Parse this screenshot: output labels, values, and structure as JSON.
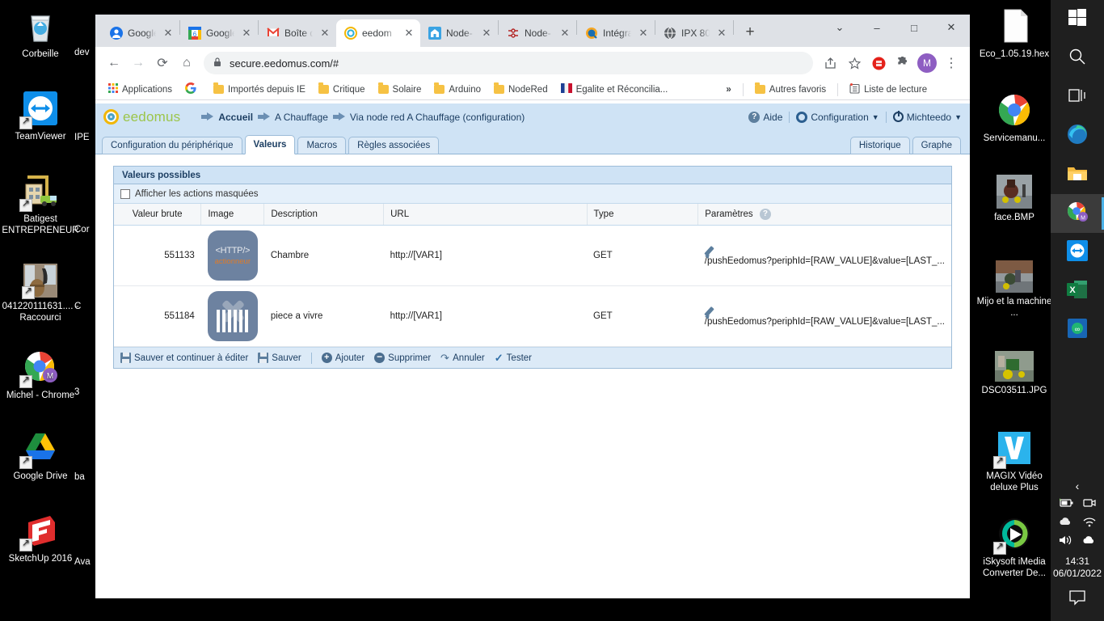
{
  "desktop": {
    "left_icons": [
      {
        "label": "Corbeille",
        "icon": "recycle-bin-icon"
      },
      {
        "label": "TeamViewer",
        "icon": "teamviewer-icon"
      },
      {
        "label": "Batigest ENTREPRENEUR",
        "icon": "batigest-icon"
      },
      {
        "label": "041220111631.... - Raccourci",
        "icon": "image-shortcut-icon"
      },
      {
        "label": "Michel - Chrome",
        "icon": "chrome-profile-icon"
      },
      {
        "label": "Google Drive",
        "icon": "google-drive-icon"
      },
      {
        "label": "SketchUp 2016",
        "icon": "sketchup-icon"
      }
    ],
    "left_icons_clipped": [
      "dev",
      "IPE",
      "Cor",
      "C",
      "3",
      "ba",
      "Ava"
    ],
    "right_icons": [
      {
        "label": "Eco_1.05.19.hex",
        "icon": "file-icon"
      },
      {
        "label": "Servicemanu...",
        "icon": "chrome-icon"
      },
      {
        "label": "face.BMP",
        "icon": "photo-thumbnail-icon"
      },
      {
        "label": "Mijo et la machine ...",
        "icon": "photo-thumbnail-icon"
      },
      {
        "label": "DSC03511.JPG",
        "icon": "photo-thumbnail-icon"
      },
      {
        "label": "MAGIX Vidéo deluxe Plus",
        "icon": "magix-icon"
      },
      {
        "label": "iSkysoft iMedia Converter De...",
        "icon": "iskysoft-icon"
      }
    ]
  },
  "taskbar": {
    "items": [
      {
        "name": "start-button",
        "icon": "windows-logo-icon"
      },
      {
        "name": "search-button",
        "icon": "search-icon"
      },
      {
        "name": "task-view-button",
        "icon": "task-view-icon"
      },
      {
        "name": "edge-button",
        "icon": "edge-icon"
      },
      {
        "name": "file-explorer-button",
        "icon": "folder-icon"
      },
      {
        "name": "chrome-button",
        "icon": "chrome-profile-icon",
        "active": true
      },
      {
        "name": "teamviewer-button",
        "icon": "teamviewer-icon"
      },
      {
        "name": "excel-button",
        "icon": "excel-icon"
      },
      {
        "name": "app-button",
        "icon": "blue-app-icon"
      }
    ],
    "tray": {
      "expand": "show-hidden-icons-icon",
      "icons": [
        "battery-icon",
        "camera-icon",
        "onedrive-cloud-icon",
        "wifi-icon",
        "volume-icon",
        "cloud-upload-icon"
      ],
      "time": "14:31",
      "date": "06/01/2022",
      "notifications": "action-center-icon"
    }
  },
  "browser": {
    "tabs": [
      {
        "title": "Google",
        "favicon": "google-account-icon",
        "active": false
      },
      {
        "title": "Google",
        "favicon": "google-calendar-icon",
        "active": false
      },
      {
        "title": "Boîte d",
        "favicon": "gmail-icon",
        "active": false
      },
      {
        "title": "eedom",
        "favicon": "eedomus-icon",
        "active": true
      },
      {
        "title": "Node-",
        "favicon": "nodered-dashboard-icon",
        "active": false
      },
      {
        "title": "Node-",
        "favicon": "nodered-icon",
        "active": false
      },
      {
        "title": "Intégra",
        "favicon": "integra-icon",
        "active": false
      },
      {
        "title": "IPX 80",
        "favicon": "globe-icon",
        "active": false
      }
    ],
    "new_tab": "+",
    "window_controls": {
      "minimize": "–",
      "maximize": "□",
      "close": "✕",
      "chevron": "⌄"
    },
    "nav": {
      "back": "←",
      "forward": "→",
      "reload": "⟳",
      "home": "⌂"
    },
    "omnibox": {
      "url": "secure.eedomus.com/#",
      "lock": "lock-icon"
    },
    "toolbar_right": {
      "share": "share-icon",
      "bookmark": "star-icon",
      "extension1": "opera-extension-icon",
      "extension2": "puzzle-extension-icon",
      "profile": "M",
      "menu": "⋮"
    },
    "bookmarks": [
      {
        "label": "Applications",
        "icon": "apps-grid-icon"
      },
      {
        "label": "",
        "icon": "google-g-icon"
      },
      {
        "label": "Importés depuis IE",
        "icon": "folder-icon"
      },
      {
        "label": "Critique",
        "icon": "folder-icon"
      },
      {
        "label": "Solaire",
        "icon": "folder-icon"
      },
      {
        "label": "Arduino",
        "icon": "folder-icon"
      },
      {
        "label": "NodeRed",
        "icon": "folder-icon"
      },
      {
        "label": "Egalite et Réconcilia...",
        "icon": "flag-icon"
      }
    ],
    "bookmarks_overflow": "»",
    "bookmarks_other": {
      "label": "Autres favoris",
      "icon": "folder-icon"
    },
    "reading_list": {
      "label": "Liste de lecture",
      "icon": "reading-list-icon"
    }
  },
  "eedomus": {
    "logo_text": "eedomus",
    "breadcrumbs": [
      "Accueil",
      "A Chauffage",
      "Via node red A Chauffage (configuration)"
    ],
    "header_right": {
      "help": "Aide",
      "config": "Configuration",
      "user": "Michteedo"
    },
    "tabs": [
      {
        "label": "Configuration du périphérique",
        "active": false
      },
      {
        "label": "Valeurs",
        "active": true
      },
      {
        "label": "Macros",
        "active": false
      },
      {
        "label": "Règles associées",
        "active": false
      }
    ],
    "tabs_right": [
      {
        "label": "Historique"
      },
      {
        "label": "Graphe"
      }
    ],
    "panel": {
      "title": "Valeurs possibles",
      "checkbox_label": "Afficher les actions masquées",
      "checkbox_checked": false,
      "columns": [
        "Valeur brute",
        "Image",
        "Description",
        "URL",
        "Type",
        "Paramètres"
      ],
      "parameters_help_icon": "question-mark-icon",
      "rows": [
        {
          "raw_value": "551133",
          "image_icon": "http-actionneur-icon",
          "image_text": "<HTTP/>",
          "image_subtext": "actionneur",
          "description": "Chambre",
          "url": "http://[VAR1]",
          "type": "GET",
          "parameters": "/pushEedomus?periphId=[RAW_VALUE]&value=[LAST_...",
          "edit_icon": "pencil-icon"
        },
        {
          "raw_value": "551184",
          "image_icon": "barcode-icon",
          "image_text": "",
          "image_subtext": "",
          "description": "piece a vivre",
          "url": "http://[VAR1]",
          "type": "GET",
          "parameters": "/pushEedomus?periphId=[RAW_VALUE]&value=[LAST_...",
          "edit_icon": "pencil-icon"
        }
      ],
      "footer_buttons": [
        {
          "label": "Sauver et continuer à éditer",
          "icon": "save-icon"
        },
        {
          "label": "Sauver",
          "icon": "save-icon"
        },
        {
          "label": "Ajouter",
          "icon": "plus-circle-icon"
        },
        {
          "label": "Supprimer",
          "icon": "minus-circle-icon"
        },
        {
          "label": "Annuler",
          "icon": "undo-icon"
        },
        {
          "label": "Tester",
          "icon": "check-icon"
        }
      ]
    }
  },
  "colors": {
    "eedomus_header": "#cfe3f5",
    "eedomus_accent": "#1d3f63",
    "logo_green": "#9cc54a",
    "logo_yellow": "#f2b705",
    "tile_bg": "#6d82a0",
    "actionneur_orange": "#e07b27",
    "chrome_tabstrip": "#dee1e6",
    "taskbar_bg": "#1f1f1f"
  }
}
